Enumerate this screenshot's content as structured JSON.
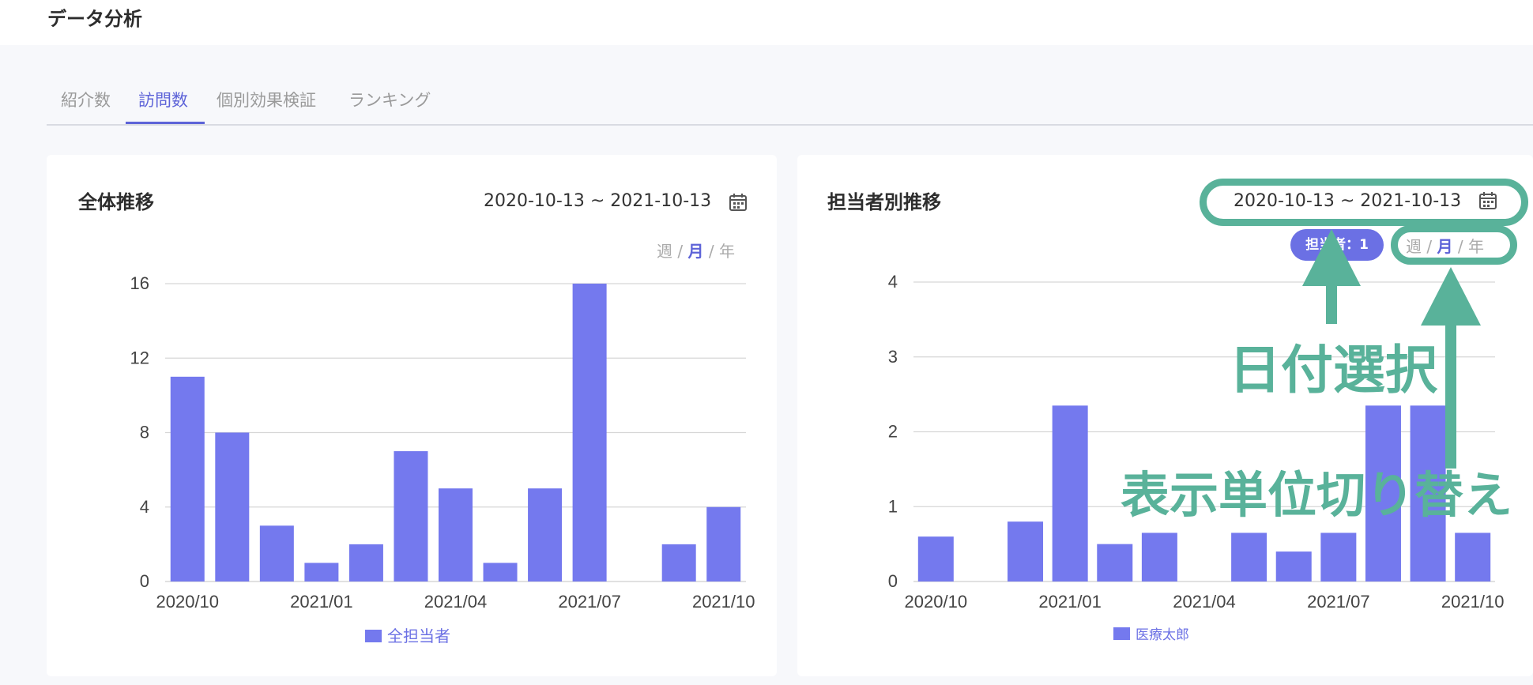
{
  "page": {
    "title": "データ分析"
  },
  "tabs": [
    {
      "label": "紹介数",
      "active": false
    },
    {
      "label": "訪問数",
      "active": true
    },
    {
      "label": "個別効果検証",
      "active": false
    },
    {
      "label": "ランキング",
      "active": false
    }
  ],
  "cards": [
    {
      "title": "全体推移",
      "date_range": "2020-10-13 ~ 2021-10-13",
      "period": {
        "week": "週",
        "month": "月",
        "year": "年",
        "sep": "/",
        "selected": "month"
      }
    },
    {
      "title": "担当者別推移",
      "date_range": "2020-10-13 ~ 2021-10-13",
      "assignee_pill": "担当者：1",
      "period": {
        "week": "週",
        "month": "月",
        "year": "年",
        "sep": "/",
        "selected": "month"
      }
    }
  ],
  "annotations": {
    "date_select": "日付選択",
    "unit_switch": "表示単位切り替え",
    "color": "#59b29a"
  },
  "chart_data": [
    {
      "type": "bar",
      "categories": [
        "2020/10",
        "2020/11",
        "2020/12",
        "2021/01",
        "2021/02",
        "2021/03",
        "2021/04",
        "2021/05",
        "2021/06",
        "2021/07",
        "2021/08",
        "2021/09",
        "2021/10"
      ],
      "x_tick_labels": [
        "2020/10",
        "2021/01",
        "2021/04",
        "2021/07",
        "2021/10"
      ],
      "y_tick_labels": [
        "0",
        "4",
        "8",
        "12",
        "16"
      ],
      "series": [
        {
          "name": "全担当者",
          "values": [
            11,
            8,
            3,
            1,
            2,
            7,
            5,
            1,
            5,
            16,
            0,
            2,
            4
          ]
        }
      ],
      "ylim": [
        0,
        16
      ],
      "grid": true,
      "legend": "bottom-center",
      "color": "#7479ee"
    },
    {
      "type": "bar",
      "categories": [
        "2020/10",
        "2020/11",
        "2020/12",
        "2021/01",
        "2021/02",
        "2021/03",
        "2021/04",
        "2021/05",
        "2021/06",
        "2021/07",
        "2021/08",
        "2021/09",
        "2021/10"
      ],
      "x_tick_labels": [
        "2020/10",
        "2021/01",
        "2021/04",
        "2021/07",
        "2021/10"
      ],
      "y_tick_labels": [
        "0",
        "1",
        "2",
        "3",
        "4"
      ],
      "series": [
        {
          "name": "医療太郎",
          "values": [
            0.6,
            0,
            0.8,
            2.35,
            0.5,
            0.65,
            0,
            0.65,
            0.4,
            0.65,
            2.35,
            2.35,
            0.65
          ]
        }
      ],
      "ylim": [
        0,
        4
      ],
      "grid": true,
      "legend": "bottom-center",
      "color": "#7479ee"
    }
  ]
}
